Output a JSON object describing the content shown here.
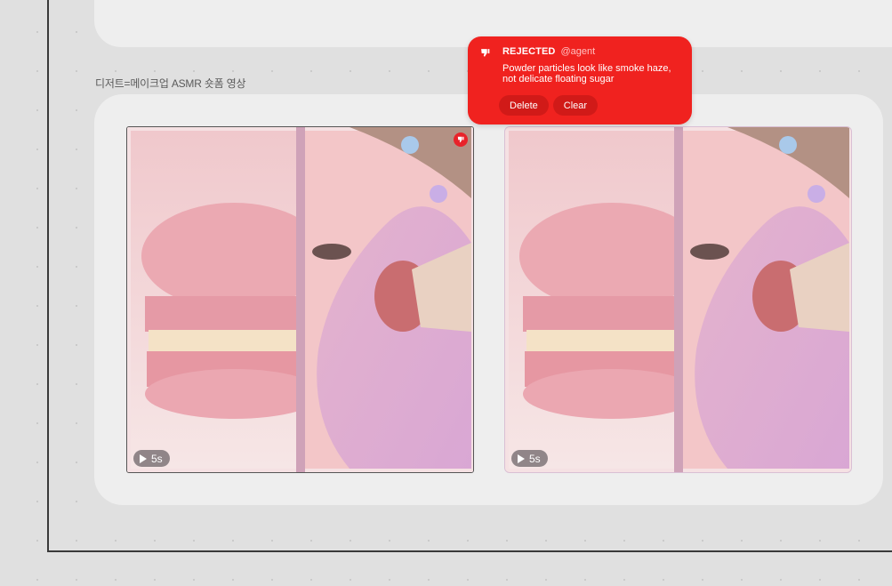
{
  "section": {
    "label": "디저트=메이크업 ASMR 숏폼 영상"
  },
  "thumbnails": [
    {
      "duration": "5s",
      "status": "rejected"
    },
    {
      "duration": "5s",
      "status": "none"
    }
  ],
  "popover": {
    "status": "REJECTED",
    "user": "@agent",
    "message": "Powder particles look like smoke haze, not delicate floating sugar",
    "delete_label": "Delete",
    "clear_label": "Clear"
  },
  "icons": {
    "popover_icon": "thumbs-down-icon",
    "badge_icon": "play-icon",
    "reject_marker": "thumbs-down-icon"
  },
  "colors": {
    "reject_red": "#f0221f",
    "panel_bg": "#eeeeee",
    "canvas_bg": "#e0e0e0"
  }
}
